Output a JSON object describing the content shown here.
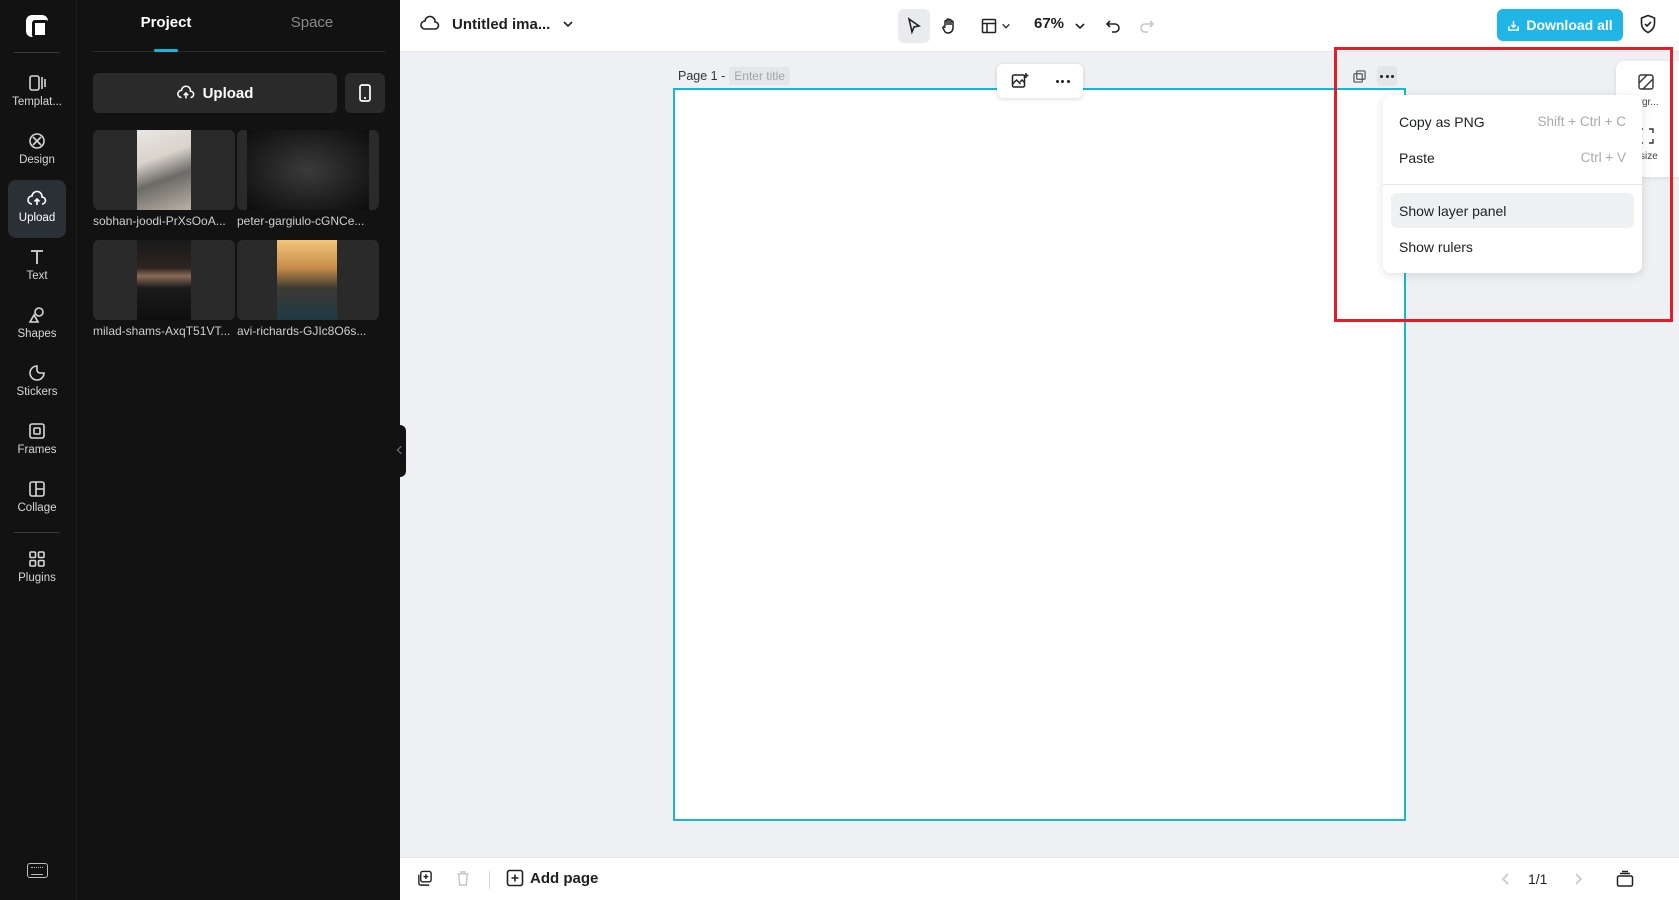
{
  "rail": {
    "items": [
      {
        "label": "Templat..."
      },
      {
        "label": "Design"
      },
      {
        "label": "Upload"
      },
      {
        "label": "Text"
      },
      {
        "label": "Shapes"
      },
      {
        "label": "Stickers"
      },
      {
        "label": "Frames"
      },
      {
        "label": "Collage"
      },
      {
        "label": "Plugins"
      }
    ]
  },
  "panel": {
    "tabs": [
      {
        "label": "Project"
      },
      {
        "label": "Space"
      }
    ],
    "upload_label": "Upload",
    "files": [
      {
        "name": "sobhan-joodi-PrXsOoA..."
      },
      {
        "name": "peter-gargiulo-cGNCe..."
      },
      {
        "name": "milad-shams-AxqT51VT..."
      },
      {
        "name": "avi-richards-GJIc8O6s..."
      }
    ]
  },
  "topbar": {
    "doc_title": "Untitled ima...",
    "zoom": "67%",
    "download_label": "Download all"
  },
  "canvas": {
    "page_label": "Page 1 -",
    "title_placeholder": "Enter title"
  },
  "right_strip": {
    "item1": "kgr...",
    "item2": "size"
  },
  "context_menu": {
    "items": [
      {
        "label": "Copy as PNG",
        "shortcut": "Shift + Ctrl + C"
      },
      {
        "label": "Paste",
        "shortcut": "Ctrl + V"
      },
      {
        "label": "Show layer panel",
        "shortcut": ""
      },
      {
        "label": "Show rulers",
        "shortcut": ""
      }
    ]
  },
  "bottombar": {
    "add_page_label": "Add page",
    "pager": "1/1"
  },
  "colors": {
    "accent": "#1fb5e6",
    "canvas_border": "#19b6d2",
    "annotation": "#e11d2a"
  }
}
